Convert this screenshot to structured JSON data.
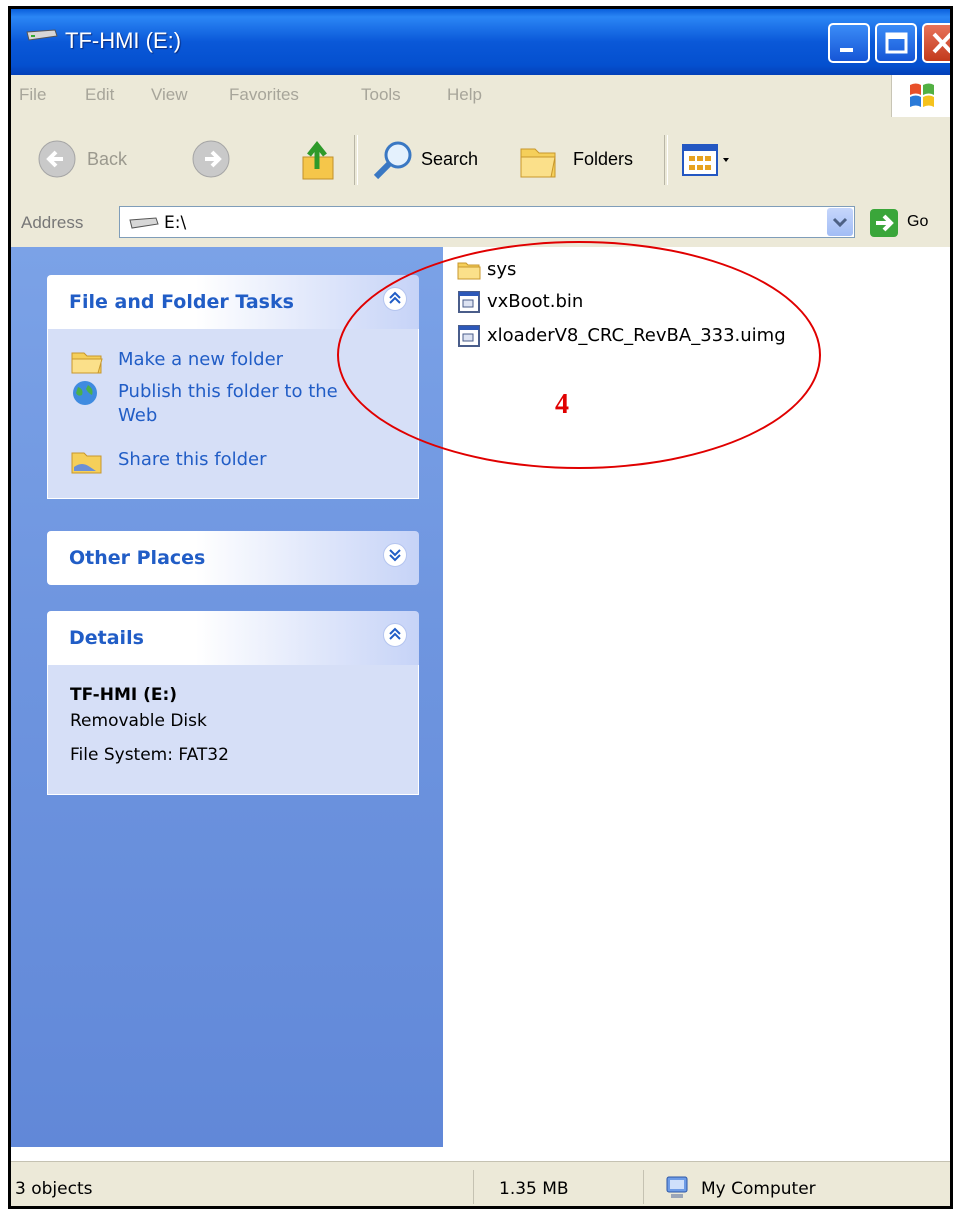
{
  "window": {
    "title": "TF-HMI (E:)"
  },
  "menu": {
    "items": [
      "File",
      "Edit",
      "View",
      "Favorites",
      "Tools",
      "Help"
    ]
  },
  "toolbar": {
    "back_label": "Back",
    "search_label": "Search",
    "folders_label": "Folders"
  },
  "address": {
    "label": "Address",
    "value": "E:\\",
    "go_label": "Go"
  },
  "file_tasks": {
    "title": "File and Folder Tasks",
    "items": [
      {
        "label_lines": [
          "Make a new folder"
        ],
        "icon": "new-folder-icon"
      },
      {
        "label_lines": [
          "Publish this folder to the",
          "Web"
        ],
        "icon": "globe-icon"
      },
      {
        "label_lines": [
          "Share this folder"
        ],
        "icon": "share-folder-icon"
      }
    ]
  },
  "other_places": {
    "title": "Other Places"
  },
  "details": {
    "title": "Details",
    "name": "TF-HMI (E:)",
    "type": "Removable Disk",
    "filesystem": "File System: FAT32"
  },
  "files": [
    {
      "name": "sys",
      "icon": "folder-icon"
    },
    {
      "name": "vxBoot.bin",
      "icon": "file-icon"
    },
    {
      "name": "xloaderV8_CRC_RevBA_333.uimg",
      "icon": "file-icon"
    }
  ],
  "annotation": {
    "label": "4",
    "color": "#e00000"
  },
  "status": {
    "objects": "3 objects",
    "size": "1.35 MB",
    "location": "My Computer"
  },
  "colors": {
    "titlebar": "#0a58d8",
    "taskpane": "#6f96e0",
    "link": "#215dc6"
  }
}
